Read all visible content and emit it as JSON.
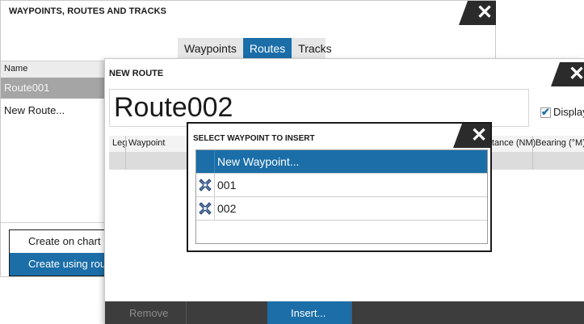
{
  "window_routes": {
    "title": "WAYPOINTS, ROUTES AND TRACKS",
    "close_icon": "close-icon",
    "tabs": [
      {
        "label": "Waypoints",
        "active": false
      },
      {
        "label": "Routes",
        "active": true
      },
      {
        "label": "Tracks",
        "active": false
      }
    ],
    "list_header": "Name",
    "routes": [
      "Route001",
      "New Route..."
    ]
  },
  "context_menu": {
    "items": [
      "Create on chart",
      "Create using rou"
    ]
  },
  "new_route": {
    "title": "NEW ROUTE",
    "route_name": "Route002",
    "display_label": "Display",
    "display_checked": true,
    "columns": {
      "leg": "Leg",
      "waypoint": "Waypoint",
      "distance": "Distance (NM)",
      "bearing": "Bearing (°M)"
    },
    "buttons": {
      "remove": "Remove",
      "insert": "Insert..."
    }
  },
  "select_waypoint": {
    "title": "SELECT WAYPOINT TO INSERT",
    "options": [
      "New Waypoint...",
      "001",
      "002"
    ],
    "waypoint_icon": "waypoint-marker-icon"
  },
  "colors": {
    "accent": "#1b6ea8",
    "title_bar_dark": "#2b2b2b",
    "bottom_bar": "#3d3d3d",
    "selected_row_gray": "#a5a5a5"
  }
}
